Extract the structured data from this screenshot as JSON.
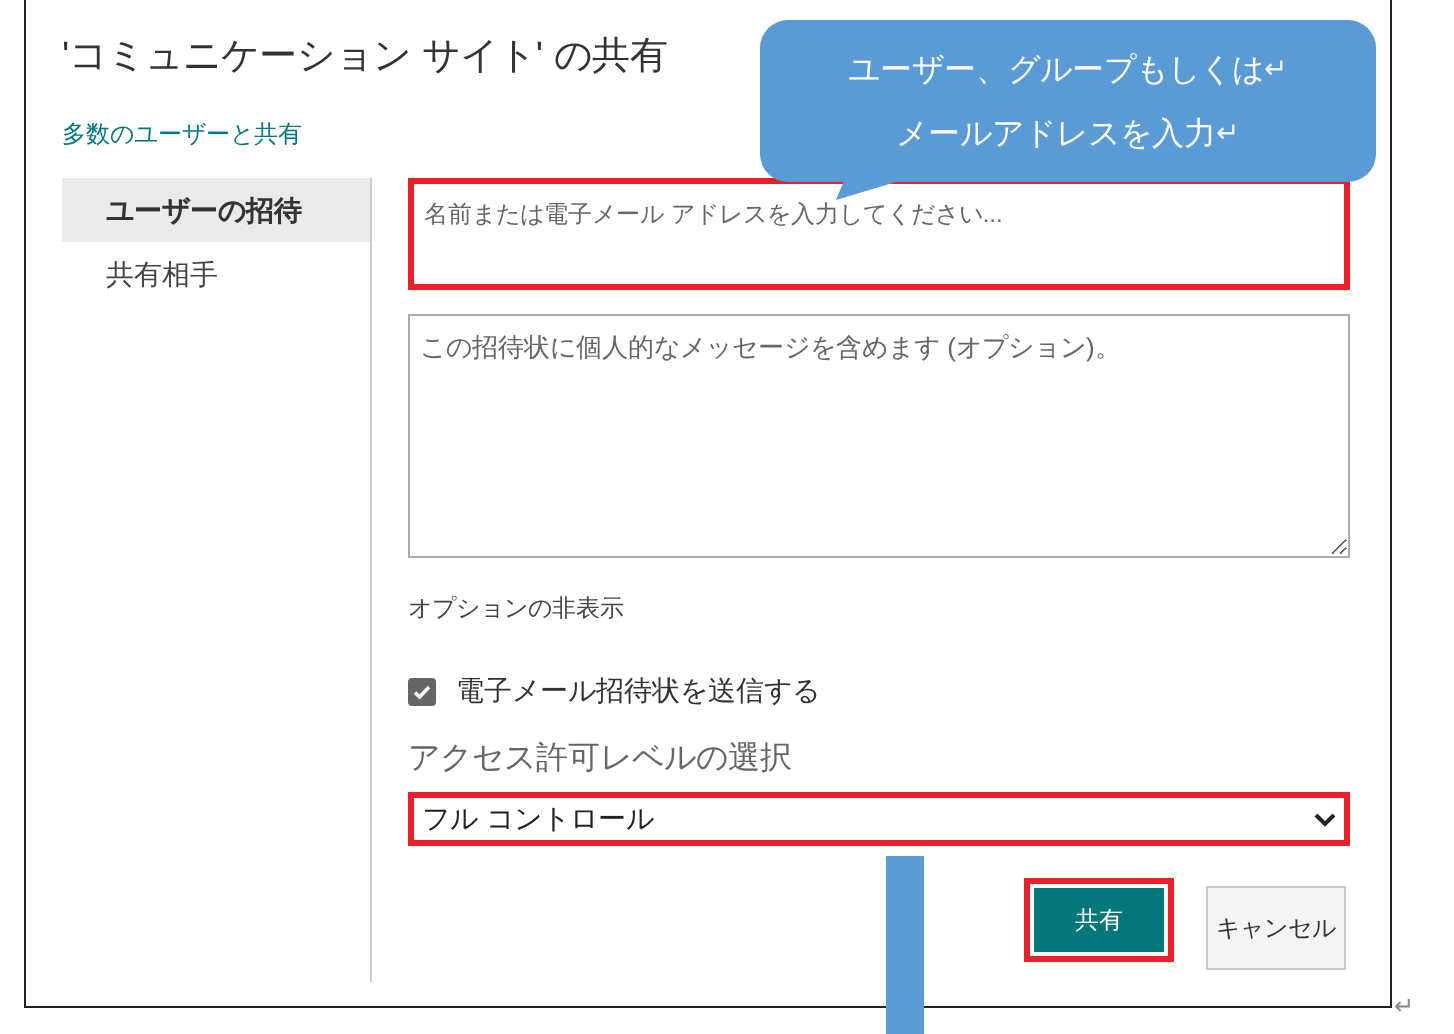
{
  "dialog": {
    "title": "'コミュニケーション サイト' の共有",
    "share_link": "多数のユーザーと共有"
  },
  "sidebar": {
    "items": [
      {
        "label": "ユーザーの招待",
        "selected": true
      },
      {
        "label": "共有相手",
        "selected": false
      }
    ]
  },
  "form": {
    "names_field": {
      "placeholder": "名前または電子メール アドレスを入力してください...",
      "highlighted": true
    },
    "message_field": {
      "placeholder": "この招待状に個人的なメッセージを含めます (オプション)。"
    },
    "options_toggle": "オプションの非表示",
    "send_email": {
      "label": "電子メール招待状を送信する",
      "checked": true
    },
    "permission_label": "アクセス許可レベルの選択",
    "permission_select": {
      "value": "フル コントロール",
      "highlighted": true
    },
    "buttons": [
      {
        "label": "共有",
        "kind": "primary",
        "highlighted": true
      },
      {
        "label": "キャンセル",
        "kind": "secondary",
        "highlighted": false
      }
    ]
  },
  "callout": {
    "lines": [
      {
        "text": "ユーザー、グループもしくは",
        "mark": "↵"
      },
      {
        "text": "メールアドレスを入力",
        "mark": "↵"
      }
    ]
  },
  "page_mark": "↵"
}
